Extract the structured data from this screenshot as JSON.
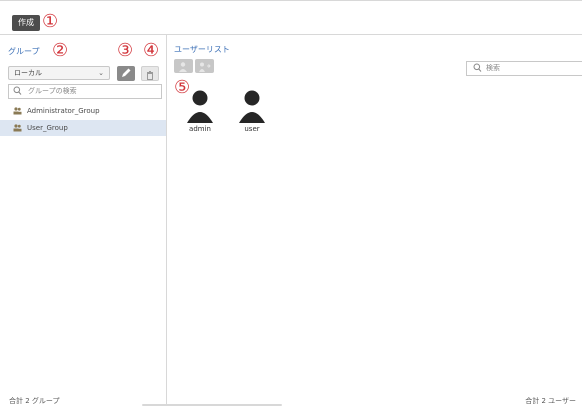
{
  "toolbar": {
    "create_label": "作成"
  },
  "markers": [
    "①",
    "②",
    "③",
    "④",
    "⑤"
  ],
  "groups_panel": {
    "title": "グループ",
    "filter_selected": "ローカル",
    "search_placeholder": "グループの検索",
    "items": [
      {
        "label": "Administrator_Group",
        "selected": false
      },
      {
        "label": "User_Group",
        "selected": true
      }
    ],
    "footer": "合計 2 グループ"
  },
  "users_panel": {
    "title": "ユーザーリスト",
    "search_placeholder": "検索",
    "users": [
      {
        "name": "admin"
      },
      {
        "name": "user"
      }
    ],
    "footer": "合計 2 ユーザー"
  },
  "colors": {
    "accent": "#3b6fb6",
    "marker": "#d2343a",
    "selection": "#dde6f2"
  },
  "icons": [
    "pencil-icon",
    "trash-icon",
    "search-icon",
    "group-icon",
    "user-icon",
    "add-user-icon",
    "move-user-icon",
    "chevron-down-icon"
  ]
}
